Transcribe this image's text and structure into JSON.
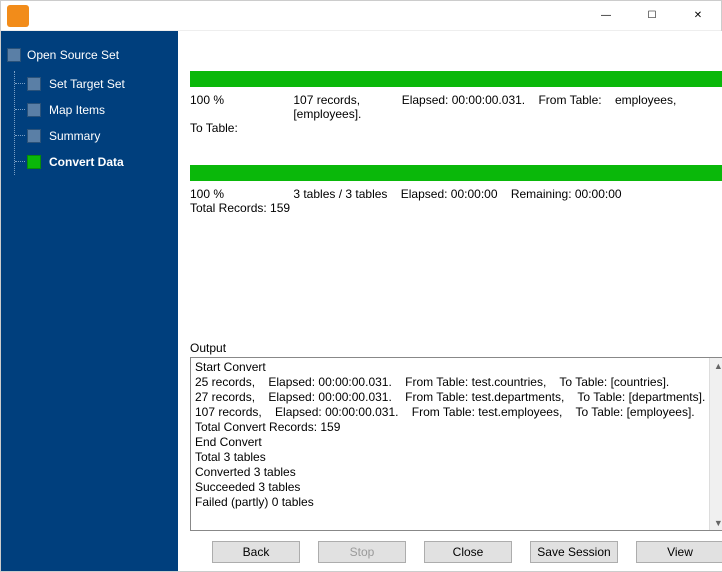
{
  "sidebar": {
    "root": "Open Source Set",
    "items": [
      {
        "label": "Set Target Set",
        "active": false
      },
      {
        "label": "Map Items",
        "active": false
      },
      {
        "label": "Summary",
        "active": false
      },
      {
        "label": "Convert Data",
        "active": true
      }
    ]
  },
  "progress1": {
    "pct": "100 %",
    "records": "107 records, [employees].",
    "elapsed": "Elapsed: 00:00:00.031.",
    "from": "From Table:",
    "from_val": "employees,",
    "to": "To Table:"
  },
  "progress2": {
    "pct": "100 %",
    "tables": "3 tables / 3 tables",
    "elapsed": "Elapsed: 00:00:00",
    "remaining": "Remaining: 00:00:00",
    "total": "Total Records: 159"
  },
  "output": {
    "label": "Output",
    "lines": [
      "Start Convert",
      "25 records,    Elapsed: 00:00:00.031.    From Table: test.countries,    To Table: [countries].",
      "27 records,    Elapsed: 00:00:00.031.    From Table: test.departments,    To Table: [departments].",
      "107 records,    Elapsed: 00:00:00.031.    From Table: test.employees,    To Table: [employees].",
      "Total Convert Records: 159",
      "End Convert",
      "Total 3 tables",
      "Converted 3 tables",
      "Succeeded 3 tables",
      "Failed (partly) 0 tables",
      ""
    ]
  },
  "buttons": {
    "back": "Back",
    "stop": "Stop",
    "close": "Close",
    "save": "Save Session",
    "view": "View"
  },
  "win": {
    "min": "—",
    "max": "☐",
    "close": "✕"
  }
}
